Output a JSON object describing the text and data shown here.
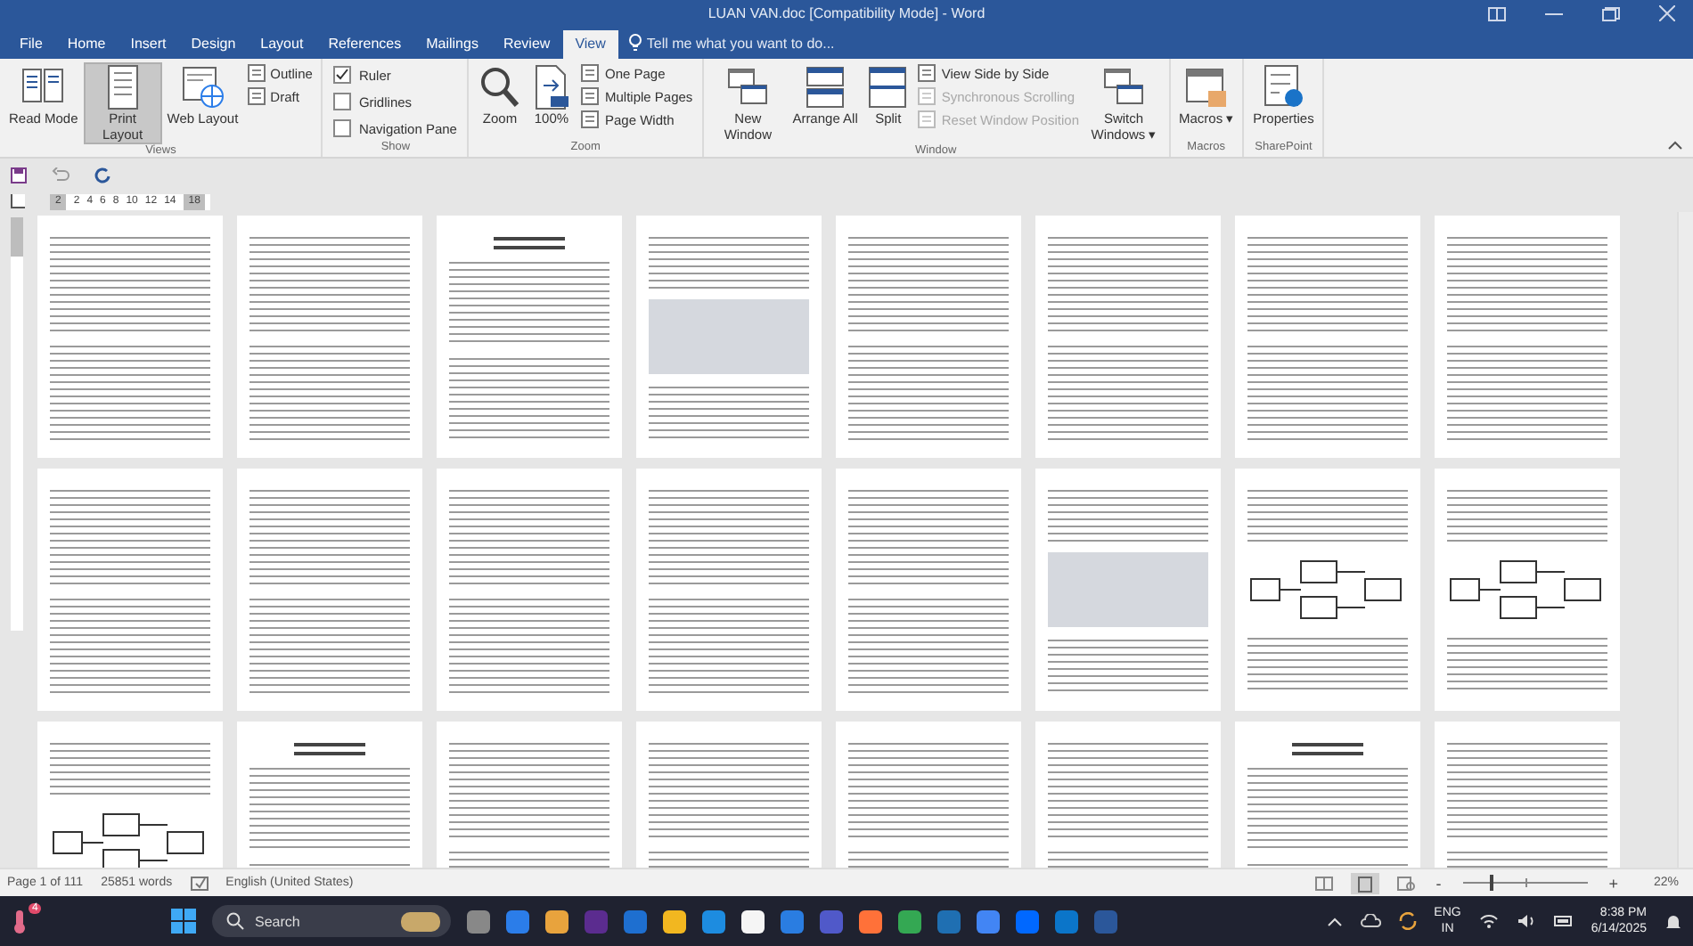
{
  "window": {
    "title": "LUAN VAN.doc [Compatibility Mode] - Word"
  },
  "tabs": [
    {
      "label": "File",
      "selected": false
    },
    {
      "label": "Home",
      "selected": false
    },
    {
      "label": "Insert",
      "selected": false
    },
    {
      "label": "Design",
      "selected": false
    },
    {
      "label": "Layout",
      "selected": false
    },
    {
      "label": "References",
      "selected": false
    },
    {
      "label": "Mailings",
      "selected": false
    },
    {
      "label": "Review",
      "selected": false
    },
    {
      "label": "View",
      "selected": true
    }
  ],
  "tell_me": {
    "placeholder": "Tell me what you want to do..."
  },
  "ribbon": [
    {
      "name": "Views",
      "items": [
        {
          "kind": "large",
          "label": "Read Mode",
          "selected": false
        },
        {
          "kind": "large",
          "label": "Print Layout",
          "selected": true
        },
        {
          "kind": "large",
          "label": "Web Layout",
          "selected": false
        },
        {
          "kind": "small",
          "label": "Outline"
        },
        {
          "kind": "small",
          "label": "Draft"
        }
      ]
    },
    {
      "name": "Show",
      "items": [
        {
          "kind": "check",
          "label": "Ruler",
          "checked": true
        },
        {
          "kind": "check",
          "label": "Gridlines",
          "checked": false
        },
        {
          "kind": "check",
          "label": "Navigation Pane",
          "checked": false
        }
      ]
    },
    {
      "name": "Zoom",
      "items": [
        {
          "kind": "large",
          "label": "Zoom"
        },
        {
          "kind": "large",
          "label": "100%"
        },
        {
          "kind": "small",
          "label": "One Page"
        },
        {
          "kind": "small",
          "label": "Multiple Pages"
        },
        {
          "kind": "small",
          "label": "Page Width"
        }
      ]
    },
    {
      "name": "Window",
      "items": [
        {
          "kind": "large",
          "label": "New Window"
        },
        {
          "kind": "large",
          "label": "Arrange All"
        },
        {
          "kind": "large",
          "label": "Split"
        },
        {
          "kind": "small",
          "label": "View Side by Side",
          "disabled": false
        },
        {
          "kind": "small",
          "label": "Synchronous Scrolling",
          "disabled": true
        },
        {
          "kind": "small",
          "label": "Reset Window Position",
          "disabled": true
        },
        {
          "kind": "large",
          "label": "Switch Windows ▾"
        }
      ]
    },
    {
      "name": "Macros",
      "items": [
        {
          "kind": "large",
          "label": "Macros ▾"
        }
      ]
    },
    {
      "name": "SharePoint",
      "items": [
        {
          "kind": "large",
          "label": "Properties"
        }
      ]
    }
  ],
  "ruler": [
    "2",
    "2",
    "4",
    "6",
    "8",
    "10",
    "12",
    "14",
    "18"
  ],
  "pages": [
    {
      "kind": "text"
    },
    {
      "kind": "text"
    },
    {
      "kind": "chapter"
    },
    {
      "kind": "figure"
    },
    {
      "kind": "text"
    },
    {
      "kind": "text"
    },
    {
      "kind": "text"
    },
    {
      "kind": "text"
    },
    {
      "kind": "text"
    },
    {
      "kind": "text"
    },
    {
      "kind": "text"
    },
    {
      "kind": "text"
    },
    {
      "kind": "text"
    },
    {
      "kind": "figure"
    },
    {
      "kind": "diagram"
    },
    {
      "kind": "diagram"
    },
    {
      "kind": "diagram"
    },
    {
      "kind": "chapter"
    },
    {
      "kind": "text"
    },
    {
      "kind": "text"
    },
    {
      "kind": "text"
    },
    {
      "kind": "text"
    },
    {
      "kind": "chapter"
    },
    {
      "kind": "text"
    }
  ],
  "status_bar": {
    "page": "Page 1 of 111",
    "words": "25851 words",
    "language": "English (United States)",
    "zoom_out": "-",
    "zoom_in": "+",
    "level": 0.22,
    "zoom": "22%"
  },
  "taskbar": {
    "widget_badge": "4",
    "search": "Search",
    "language": "ENG",
    "region": "IN",
    "time": "8:38 PM",
    "date": "6/14/2025"
  }
}
